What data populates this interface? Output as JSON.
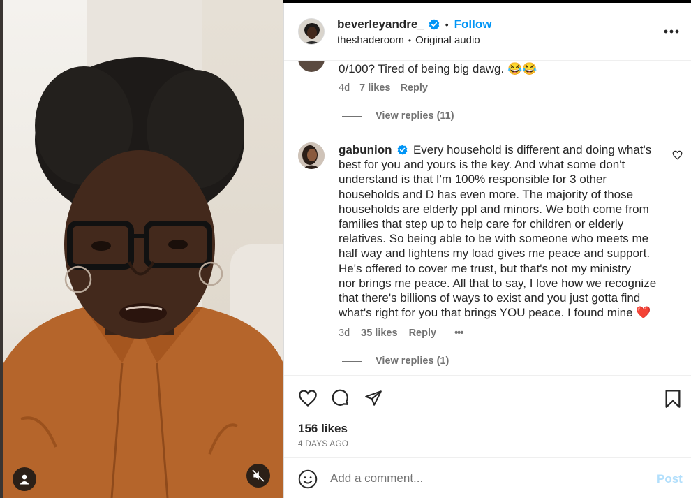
{
  "header": {
    "username": "beverleyandre_",
    "separator": "•",
    "follow_label": "Follow",
    "subtitle_account": "theshaderoom",
    "subtitle_separator": "•",
    "subtitle_audio": "Original audio",
    "more_icon": "more-horizontal-icon"
  },
  "comments": [
    {
      "text": "0/100? Tired of being big dawg. 😂😂",
      "time": "4d",
      "likes": "7 likes",
      "reply_label": "Reply",
      "view_replies": "View replies (11)"
    },
    {
      "username": "gabunion",
      "text_lines": [
        "Every household is different and doing what's",
        "best for you and yours is the key. And what some don't",
        "understand is that I'm 100% responsible for 3 other",
        "households and D has even more. The majority of those",
        "households are elderly ppl and minors. We both come from",
        "families that step up to help care for children or elderly",
        "relatives. So being able to be with someone who meets me",
        "half way and lightens my load gives me peace and support.",
        "He's offered to cover me trust, but that's not my ministry",
        "nor brings me peace. All that to say, I love how we recognize",
        "that there's billions of ways to exist and you just gotta find",
        "what's right for you that brings YOU peace. I found mine ❤️"
      ],
      "time": "3d",
      "likes": "35 likes",
      "reply_label": "Reply",
      "more_label": "•••",
      "view_replies": "View replies (1)"
    }
  ],
  "post": {
    "likes": "156 likes",
    "date": "4 DAYS AGO"
  },
  "add_comment": {
    "placeholder": "Add a comment...",
    "post_label": "Post"
  },
  "colors": {
    "accent": "#0095f6",
    "verified": "#0095f6",
    "shirt": "#b5652b",
    "heart_emoji": "#e0245e"
  }
}
